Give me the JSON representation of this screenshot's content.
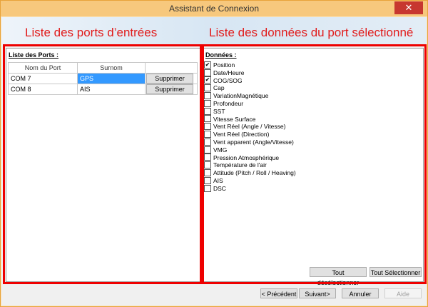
{
  "window": {
    "title": "Assistant de Connexion",
    "close_glyph": "✕"
  },
  "banner": {
    "left_text": "Liste des ports d’entrées",
    "right_text": "Liste des données du port sélectionné"
  },
  "ports": {
    "label": "Liste des Ports :",
    "columns": [
      "Nom du Port",
      "Surnom"
    ],
    "rows": [
      {
        "port": "COM 7",
        "alias": "GPS",
        "selected": true,
        "button": "Supprimer"
      },
      {
        "port": "COM 8",
        "alias": "AIS",
        "selected": false,
        "button": "Supprimer"
      }
    ]
  },
  "data_panel": {
    "label": "Données :",
    "items": [
      {
        "label": "Position",
        "checked": true
      },
      {
        "label": "Date/Heure",
        "checked": false
      },
      {
        "label": "COG/SOG",
        "checked": true
      },
      {
        "label": "Cap",
        "checked": false
      },
      {
        "label": "VariationMagnétique",
        "checked": false
      },
      {
        "label": "Profondeur",
        "checked": false
      },
      {
        "label": "SST",
        "checked": false
      },
      {
        "label": "Vitesse Surface",
        "checked": false
      },
      {
        "label": "Vent Réel (Angle / Vitesse)",
        "checked": false
      },
      {
        "label": "Vent Réel (Direction)",
        "checked": false
      },
      {
        "label": "Vent apparent (Angle/Vitesse)",
        "checked": false
      },
      {
        "label": "VMG",
        "checked": false
      },
      {
        "label": "Pression Atmosphérique",
        "checked": false
      },
      {
        "label": "Température de l'air",
        "checked": false
      },
      {
        "label": "Attitude (Pitch / Roll / Heaving)",
        "checked": false
      },
      {
        "label": "AIS",
        "checked": false
      },
      {
        "label": "DSC",
        "checked": false
      }
    ],
    "unselect_all": "Tout désélectionner",
    "select_all": "Tout Sélectionner"
  },
  "footer": {
    "previous": "< Précédent",
    "next": "Suivant>",
    "cancel": "Annuler",
    "help": "Aide"
  },
  "colors": {
    "highlight": "#e00000",
    "selection": "#3399ff",
    "banner_text": "#e11b1b"
  }
}
